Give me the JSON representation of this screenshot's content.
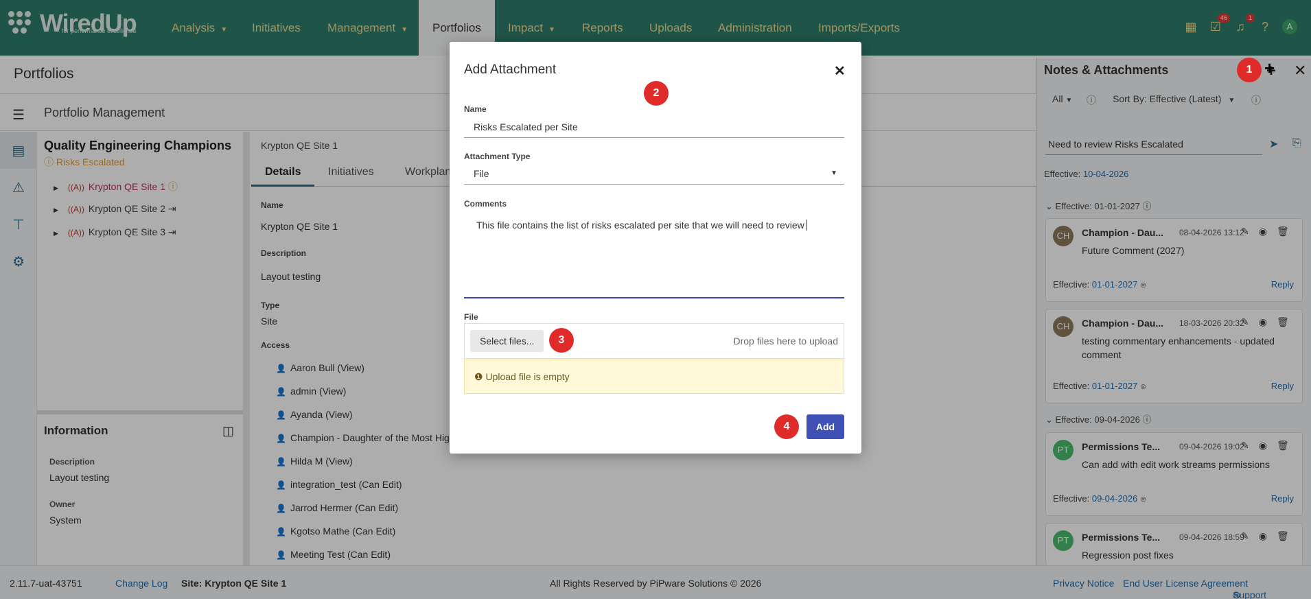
{
  "app": {
    "logo_text": "WiredUp",
    "logo_tagline": "for performance excellence"
  },
  "nav": {
    "items": [
      {
        "label": "Analysis",
        "dropdown": true
      },
      {
        "label": "Initiatives",
        "dropdown": false
      },
      {
        "label": "Management",
        "dropdown": true
      },
      {
        "label": "Portfolios",
        "dropdown": false,
        "active": true
      },
      {
        "label": "Impact",
        "dropdown": true
      },
      {
        "label": "Reports",
        "dropdown": false
      },
      {
        "label": "Uploads",
        "dropdown": false
      },
      {
        "label": "Administration",
        "dropdown": false
      },
      {
        "label": "Imports/Exports",
        "dropdown": false
      }
    ],
    "badges": {
      "tasks": "46",
      "notifications": "1"
    },
    "avatar_initial": "A"
  },
  "page": {
    "title": "Portfolios",
    "section_title": "Portfolio Management"
  },
  "tree": {
    "title": "Quality Engineering Champions",
    "warning": "Risks Escalated",
    "nodes": [
      {
        "label": "Krypton QE Site 1"
      },
      {
        "label": "Krypton QE Site 2"
      },
      {
        "label": "Krypton QE Site 3"
      }
    ]
  },
  "info": {
    "title": "Information",
    "description_label": "Description",
    "description_value": "Layout testing",
    "owner_label": "Owner",
    "owner_value": "System"
  },
  "details": {
    "breadcrumb": "Krypton QE Site 1",
    "tabs": [
      "Details",
      "Initiatives",
      "Workplan"
    ],
    "name_label": "Name",
    "name_value": "Krypton QE Site 1",
    "description_label": "Description",
    "description_value": "Layout testing",
    "type_label": "Type",
    "type_value": "Site",
    "access_label": "Access",
    "access": [
      "Aaron Bull (View)",
      "admin (View)",
      "Ayanda (View)",
      "Champion - Daughter of the Most High",
      "Hilda M (View)",
      "integration_test (Can Edit)",
      "Jarrod Hermer (Can Edit)",
      "Kgotso Mathe (Can Edit)",
      "Meeting Test (Can Edit)"
    ]
  },
  "notes": {
    "title": "Notes & Attachments",
    "filter_all": "All",
    "sort_label": "Sort By: Effective (Latest)",
    "input_value": "Need to review Risks Escalated",
    "effective_label": "Effective:",
    "effective_value": "10-04-2026",
    "groups": [
      {
        "header": "Effective: 01-01-2027",
        "cards": [
          {
            "initials": "CH",
            "name": "Champion - Dau...",
            "date": "08-04-2026 13:12",
            "text": "Future Comment (2027)",
            "effective": "01-01-2027",
            "reply": "Reply"
          },
          {
            "initials": "CH",
            "name": "Champion - Dau...",
            "date": "18-03-2026 20:32",
            "text": "testing commentary enhancements - updated comment",
            "effective": "01-01-2027",
            "reply": "Reply"
          }
        ]
      },
      {
        "header": "Effective: 09-04-2026",
        "cards": [
          {
            "initials": "PT",
            "name": "Permissions Te...",
            "date": "09-04-2026 19:02",
            "text": "Can add with edit work streams permissions",
            "effective": "09-04-2026",
            "reply": "Reply"
          },
          {
            "initials": "PT",
            "name": "Permissions Te...",
            "date": "09-04-2026 18:59",
            "text": "Regression post fixes"
          }
        ]
      }
    ]
  },
  "footer": {
    "version": "2.11.7-uat-43751",
    "changelog": "Change Log",
    "site": "Site: Krypton QE Site 1",
    "copyright": "All Rights Reserved by PiPware Solutions © 2026",
    "privacy": "Privacy Notice",
    "eula": "End User License Agreement",
    "support": "Support"
  },
  "modal": {
    "title": "Add Attachment",
    "name_label": "Name",
    "name_value": "Risks Escalated per Site",
    "type_label": "Attachment Type",
    "type_value": "File",
    "comments_label": "Comments",
    "comments_value": "This file contains the list of risks escalated per site that we will need to review",
    "file_label": "File",
    "select_files": "Select files...",
    "drop_text": "Drop files here to upload",
    "warning": "Upload file is empty",
    "add_button": "Add"
  },
  "markers": [
    "1",
    "2",
    "3",
    "4"
  ],
  "colors": {
    "nav_bg": "#2e7d6b",
    "nav_text": "#f3d98b",
    "accent": "#3f51b5",
    "marker": "#e02b2b",
    "warning": "#e39a2b"
  }
}
